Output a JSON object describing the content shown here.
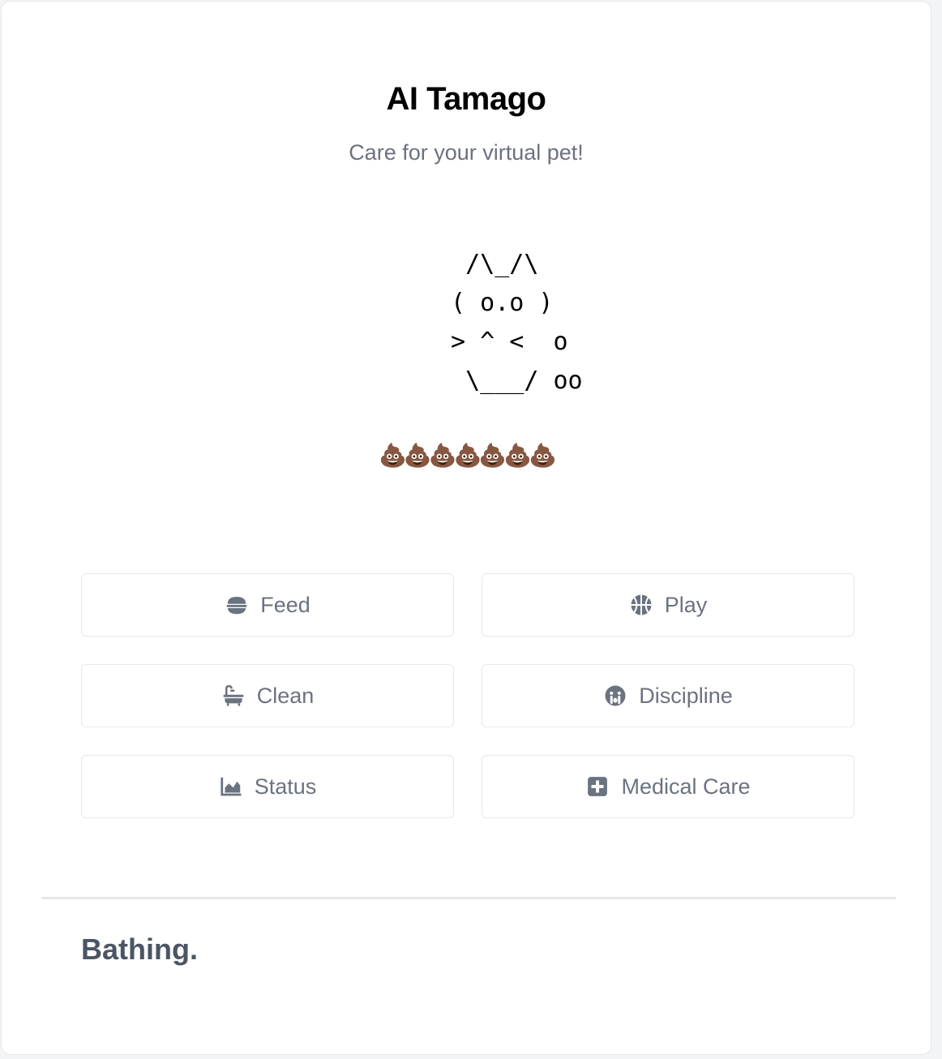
{
  "app": {
    "title": "AI Tamago",
    "subtitle": "Care for your virtual pet!"
  },
  "pet": {
    "ascii_art": "  /\\_/\\\n ( o.o )\n > ^ <  o\n  \\___/ oo",
    "poop_display": "💩💩💩💩💩💩💩",
    "poop_count": 7
  },
  "actions": {
    "feed_label": "Feed",
    "play_label": "Play",
    "clean_label": "Clean",
    "discipline_label": "Discipline",
    "status_label": "Status",
    "medical_label": "Medical Care"
  },
  "icons": {
    "feed": "food-bowl-icon",
    "play": "basketball-icon",
    "clean": "bath-icon",
    "discipline": "sad-cry-face-icon",
    "status": "area-chart-icon",
    "medical": "medical-plus-icon"
  },
  "status": {
    "message": "Bathing."
  },
  "colors": {
    "button_text": "#6b7280",
    "border": "#e5e7eb",
    "message_text": "#4b5563"
  }
}
